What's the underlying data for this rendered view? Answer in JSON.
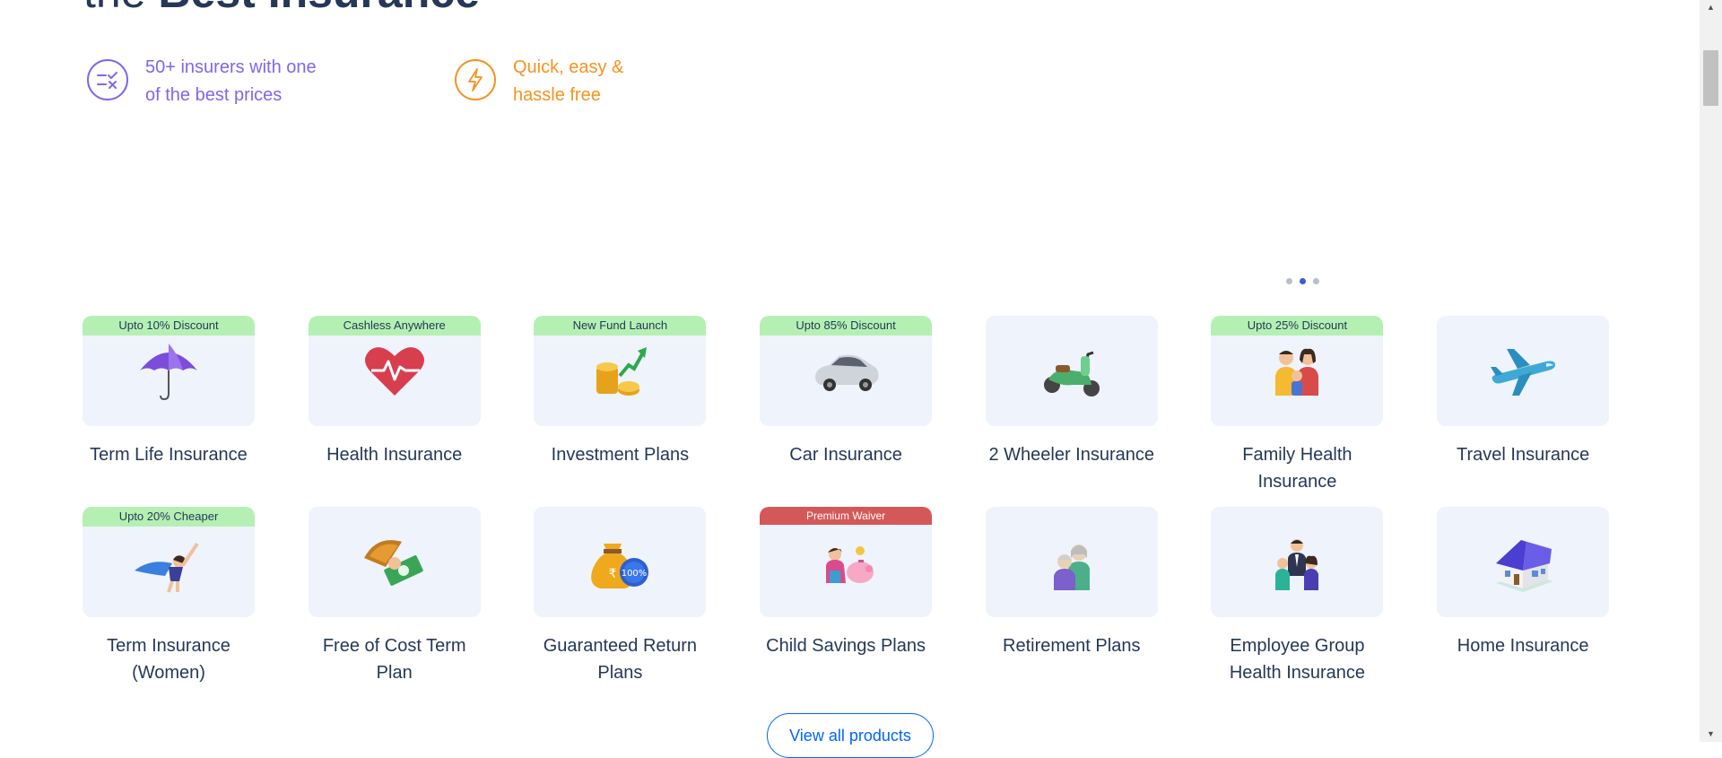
{
  "hero": {
    "title_light": "the",
    "title_bold": "Best Insurance"
  },
  "features": [
    {
      "icon": "compare-check-icon",
      "line1": "50+ insurers with one",
      "line2": "of the best prices",
      "color": "#7b68ee"
    },
    {
      "icon": "lightning-icon",
      "line1": "Quick, easy &",
      "line2": "hassle free",
      "color": "#f7921e"
    }
  ],
  "carousel": {
    "dots": 3,
    "active_dot": 2
  },
  "products": [
    {
      "label": "Term Life Insurance",
      "badge": "Upto 10% Discount",
      "badge_style": "green",
      "icon": "umbrella-icon"
    },
    {
      "label": "Health Insurance",
      "badge": "Cashless Anywhere",
      "badge_style": "green",
      "icon": "heart-pulse-icon"
    },
    {
      "label": "Investment Plans",
      "badge": "New Fund Launch",
      "badge_style": "green",
      "icon": "coins-growth-icon"
    },
    {
      "label": "Car Insurance",
      "badge": "Upto 85% Discount",
      "badge_style": "green",
      "icon": "car-icon"
    },
    {
      "label": "2 Wheeler Insurance",
      "badge": "",
      "badge_style": "none",
      "icon": "scooter-icon"
    },
    {
      "label": "Family Health Insurance",
      "badge": "Upto 25% Discount",
      "badge_style": "green",
      "icon": "family-icon"
    },
    {
      "label": "Travel Insurance",
      "badge": "",
      "badge_style": "none",
      "icon": "airplane-icon"
    },
    {
      "label": "Term Insurance (Women)",
      "badge": "Upto 20% Cheaper",
      "badge_style": "green",
      "icon": "superwoman-icon"
    },
    {
      "label": "Free of Cost Term Plan",
      "badge": "",
      "badge_style": "none",
      "icon": "umbrella-money-icon"
    },
    {
      "label": "Guaranteed Return Plans",
      "badge": "",
      "badge_style": "none",
      "icon": "money-bag-100-icon"
    },
    {
      "label": "Child Savings Plans",
      "badge": "Premium Waiver",
      "badge_style": "red",
      "icon": "child-piggy-bank-icon"
    },
    {
      "label": "Retirement Plans",
      "badge": "",
      "badge_style": "none",
      "icon": "elderly-couple-icon"
    },
    {
      "label": "Employee Group Health Insurance",
      "badge": "",
      "badge_style": "none",
      "icon": "employee-group-icon"
    },
    {
      "label": "Home Insurance",
      "badge": "",
      "badge_style": "none",
      "icon": "house-icon"
    }
  ],
  "view_all": {
    "label": "View all products"
  },
  "colors": {
    "title": "#253858",
    "card_bg": "#eef3fc",
    "badge_green": "#b5f0b3",
    "badge_red": "#d45858",
    "link_blue": "#0065ff"
  }
}
